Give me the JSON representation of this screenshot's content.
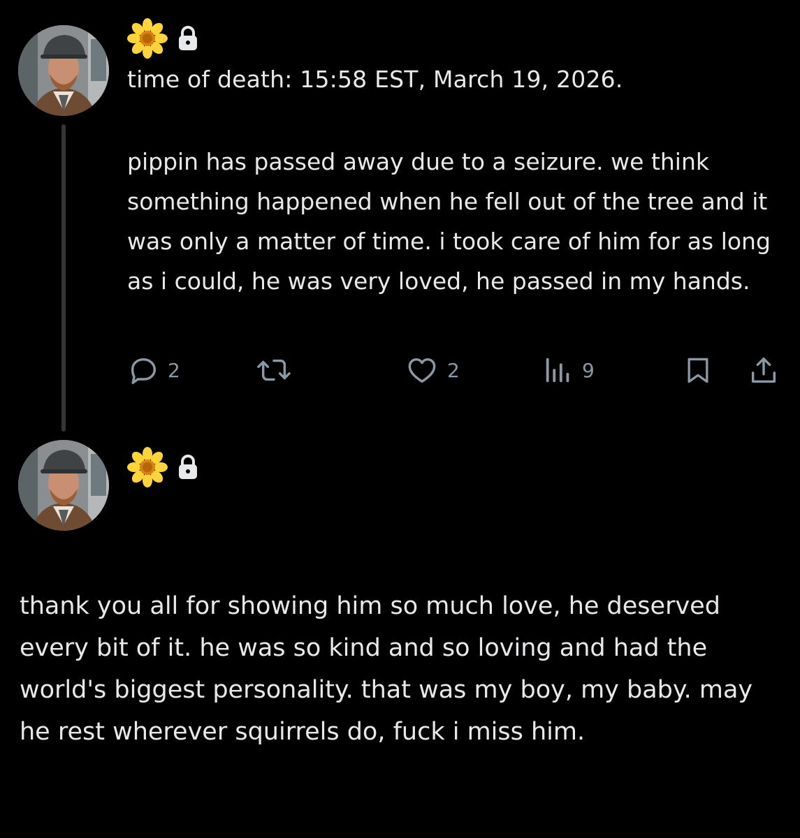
{
  "colors": {
    "background": "#000000",
    "text": "#e7e9ea",
    "muted": "#8b98a5",
    "thread_line": "#333639"
  },
  "posts": [
    {
      "avatar": "profile-photo",
      "badges": [
        "daisy-emoji-icon",
        "lock-icon"
      ],
      "timestamp_line": "time of death: 15:58 EST, March 19, 2026.",
      "body": "pippin has passed away due to a seizure. we think something happened when he fell out of the tree and it was only a matter of time. i took care of him for as long as i could, he was very loved, he passed in my hands.",
      "actions": {
        "replies": "2",
        "reposts": "",
        "likes": "2",
        "views": "9"
      },
      "icons": [
        "reply-icon",
        "repost-icon",
        "like-icon",
        "views-icon",
        "bookmark-icon",
        "share-icon"
      ]
    },
    {
      "avatar": "profile-photo",
      "badges": [
        "daisy-emoji-icon",
        "lock-icon"
      ],
      "body": "thank you all for showing him so much love, he deserved every bit of it. he was so kind and so loving and had the world's biggest personality. that was my boy, my baby. may he rest wherever squirrels do, fuck i miss him."
    }
  ]
}
